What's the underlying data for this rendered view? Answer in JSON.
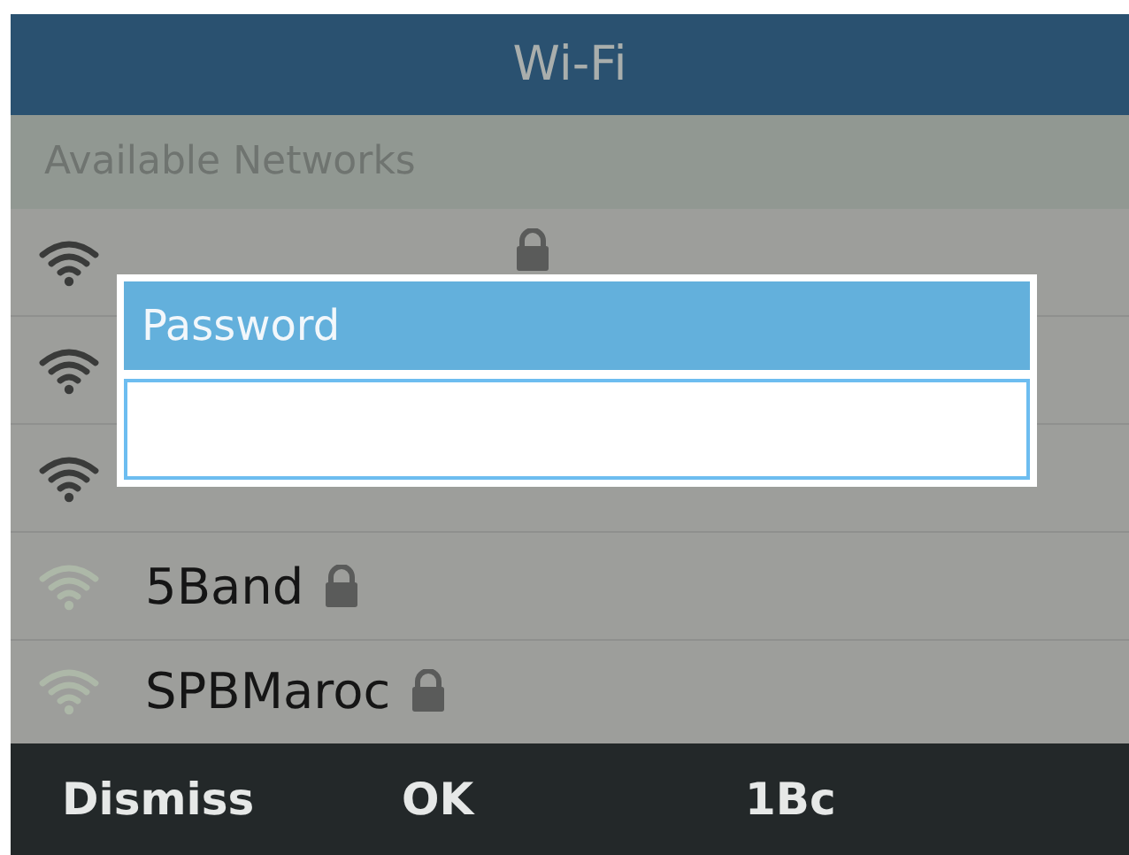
{
  "title_bar": {
    "title": "Wi-Fi"
  },
  "section_header": "Available Networks",
  "networks": [
    {
      "kind": "strong",
      "locked": true
    },
    {
      "kind": "strong"
    },
    {
      "kind": "strong"
    },
    {
      "name": "5Band",
      "kind": "weak",
      "locked": true
    },
    {
      "name": "SPBMaroc",
      "kind": "weak",
      "locked": true
    }
  ],
  "dialog": {
    "title": "Password"
  },
  "softkeys": [
    "Dismiss",
    "OK",
    "1Bc"
  ]
}
